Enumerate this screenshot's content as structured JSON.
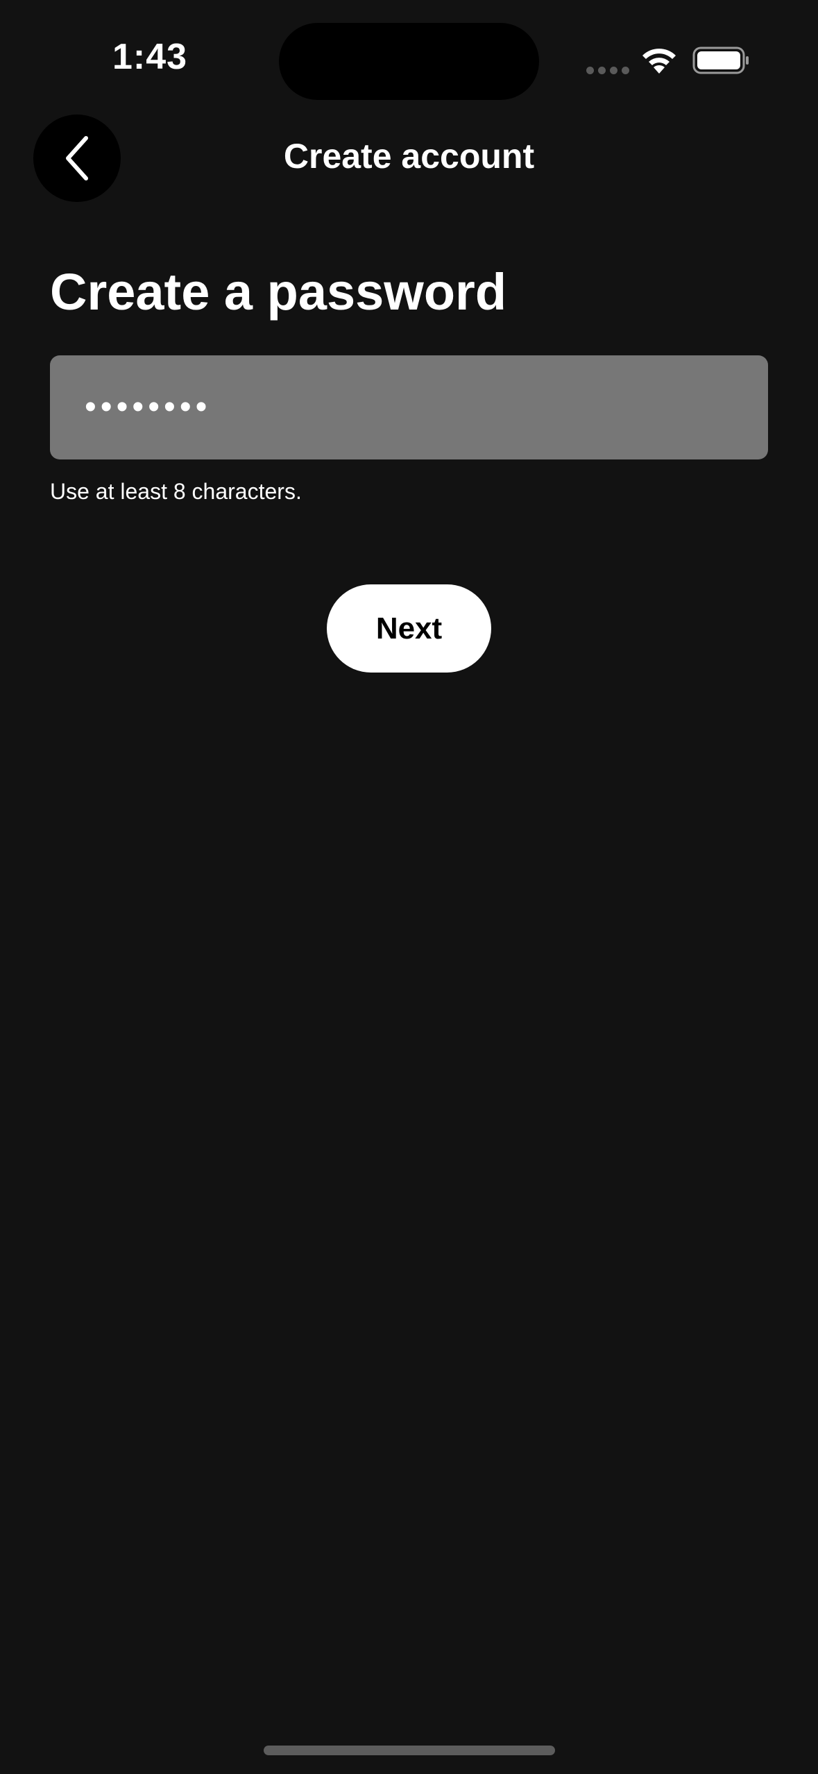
{
  "status_bar": {
    "time": "1:43",
    "icons": [
      "cellular-signal-icon",
      "wifi-icon",
      "battery-icon"
    ]
  },
  "nav": {
    "title": "Create account",
    "back_icon": "chevron-left-icon"
  },
  "form": {
    "heading": "Create a password",
    "password_value": "••••••••",
    "hint": "Use at least 8 characters.",
    "next_label": "Next"
  },
  "colors": {
    "background": "#121212",
    "field_background": "#777777",
    "button_background": "#ffffff",
    "button_text": "#000000"
  }
}
